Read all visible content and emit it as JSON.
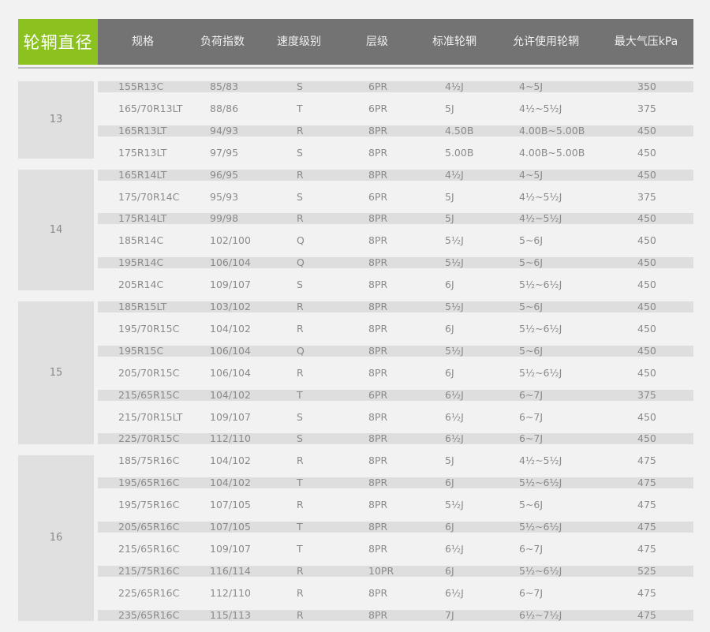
{
  "header": {
    "first": "轮辋直径",
    "columns": [
      "规格",
      "负荷指数",
      "速度级别",
      "层级",
      "标准轮辋",
      "允许使用轮辋",
      "最大气压kPa"
    ]
  },
  "groups": [
    "13",
    "14",
    "15",
    "16"
  ],
  "rows": [
    {
      "spec": "155R13C",
      "load": "85/83",
      "speed": "S",
      "ply": "6PR",
      "std": "4½J",
      "allow": "4~5J",
      "kpa": "350"
    },
    {
      "spec": "165/70R13LT",
      "load": "88/86",
      "speed": "T",
      "ply": "6PR",
      "std": "5J",
      "allow": "4½~5½J",
      "kpa": "375"
    },
    {
      "spec": "165R13LT",
      "load": "94/93",
      "speed": "R",
      "ply": "8PR",
      "std": "4.50B",
      "allow": "4.00B~5.00B",
      "kpa": "450"
    },
    {
      "spec": "175R13LT",
      "load": "97/95",
      "speed": "S",
      "ply": "8PR",
      "std": "5.00B",
      "allow": "4.00B~5.00B",
      "kpa": "450"
    },
    {
      "spec": "165R14LT",
      "load": "96/95",
      "speed": "R",
      "ply": "8PR",
      "std": "4½J",
      "allow": "4~5J",
      "kpa": "450"
    },
    {
      "spec": "175/70R14C",
      "load": "95/93",
      "speed": "S",
      "ply": "6PR",
      "std": "5J",
      "allow": "4½~5½J",
      "kpa": "375"
    },
    {
      "spec": "175R14LT",
      "load": "99/98",
      "speed": "R",
      "ply": "8PR",
      "std": "5J",
      "allow": "4½~5½J",
      "kpa": "450"
    },
    {
      "spec": "185R14C",
      "load": "102/100",
      "speed": "Q",
      "ply": "8PR",
      "std": "5½J",
      "allow": "5~6J",
      "kpa": "450"
    },
    {
      "spec": "195R14C",
      "load": "106/104",
      "speed": "Q",
      "ply": "8PR",
      "std": "5½J",
      "allow": "5~6J",
      "kpa": "450"
    },
    {
      "spec": "205R14C",
      "load": "109/107",
      "speed": "S",
      "ply": "8PR",
      "std": "6J",
      "allow": "5½~6½J",
      "kpa": "450"
    },
    {
      "spec": "185R15LT",
      "load": "103/102",
      "speed": "R",
      "ply": "8PR",
      "std": "5½J",
      "allow": "5~6J",
      "kpa": "450"
    },
    {
      "spec": "195/70R15C",
      "load": "104/102",
      "speed": "R",
      "ply": "8PR",
      "std": "6J",
      "allow": "5½~6½J",
      "kpa": "450"
    },
    {
      "spec": "195R15C",
      "load": "106/104",
      "speed": "Q",
      "ply": "8PR",
      "std": "5½J",
      "allow": "5~6J",
      "kpa": "450"
    },
    {
      "spec": "205/70R15C",
      "load": "106/104",
      "speed": "R",
      "ply": "8PR",
      "std": "6J",
      "allow": "5½~6½J",
      "kpa": "450"
    },
    {
      "spec": "215/65R15C",
      "load": "104/102",
      "speed": "T",
      "ply": "6PR",
      "std": "6½J",
      "allow": "6~7J",
      "kpa": "375"
    },
    {
      "spec": "215/70R15LT",
      "load": "109/107",
      "speed": "S",
      "ply": "8PR",
      "std": "6½J",
      "allow": "6~7J",
      "kpa": "450"
    },
    {
      "spec": "225/70R15C",
      "load": "112/110",
      "speed": "S",
      "ply": "8PR",
      "std": "6½J",
      "allow": "6~7J",
      "kpa": "450"
    },
    {
      "spec": "185/75R16C",
      "load": "104/102",
      "speed": "R",
      "ply": "8PR",
      "std": "5J",
      "allow": "4½~5½J",
      "kpa": "475"
    },
    {
      "spec": "195/65R16C",
      "load": "104/102",
      "speed": "T",
      "ply": "8PR",
      "std": "6J",
      "allow": "5½~6½J",
      "kpa": "475"
    },
    {
      "spec": "195/75R16C",
      "load": "107/105",
      "speed": "R",
      "ply": "8PR",
      "std": "5½J",
      "allow": "5~6J",
      "kpa": "475"
    },
    {
      "spec": "205/65R16C",
      "load": "107/105",
      "speed": "T",
      "ply": "8PR",
      "std": "6J",
      "allow": "5½~6½J",
      "kpa": "475"
    },
    {
      "spec": "215/65R16C",
      "load": "109/107",
      "speed": "T",
      "ply": "8PR",
      "std": "6½J",
      "allow": "6~7J",
      "kpa": "475"
    },
    {
      "spec": "215/75R16C",
      "load": "116/114",
      "speed": "R",
      "ply": "10PR",
      "std": "6J",
      "allow": "5½~6½J",
      "kpa": "525"
    },
    {
      "spec": "225/65R16C",
      "load": "112/110",
      "speed": "R",
      "ply": "8PR",
      "std": "6½J",
      "allow": "6~7J",
      "kpa": "475"
    },
    {
      "spec": "235/65R16C",
      "load": "115/113",
      "speed": "R",
      "ply": "8PR",
      "std": "7J",
      "allow": "6½~7½J",
      "kpa": "475"
    }
  ]
}
